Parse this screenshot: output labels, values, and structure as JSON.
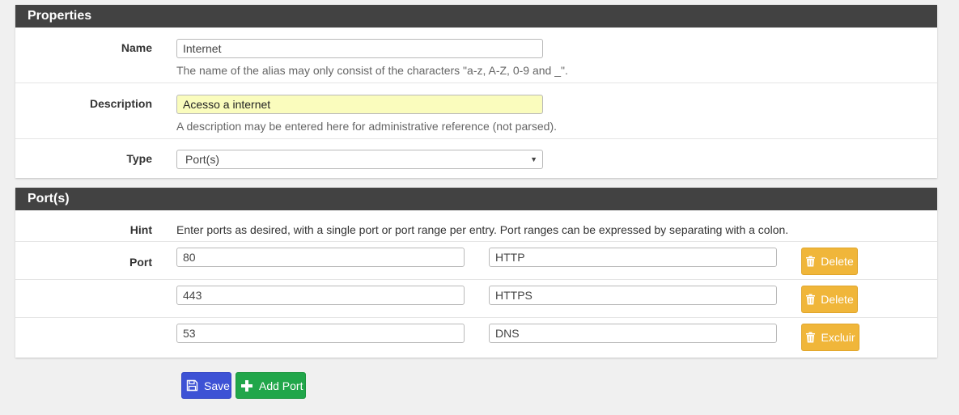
{
  "properties": {
    "heading": "Properties",
    "name": {
      "label": "Name",
      "value": "Internet",
      "help": "The name of the alias may only consist of the characters \"a-z, A-Z, 0-9 and _\"."
    },
    "description": {
      "label": "Description",
      "value": "Acesso a internet",
      "help": "A description may be entered here for administrative reference (not parsed)."
    },
    "type": {
      "label": "Type",
      "selected": "Port(s)"
    }
  },
  "ports": {
    "heading": "Port(s)",
    "hint_label": "Hint",
    "hint_text": "Enter ports as desired, with a single port or port range per entry. Port ranges can be expressed by separating with a colon.",
    "port_label": "Port",
    "entries": [
      {
        "port": "80",
        "description": "HTTP",
        "action": "Delete"
      },
      {
        "port": "443",
        "description": "HTTPS",
        "action": "Delete"
      },
      {
        "port": "53",
        "description": "DNS",
        "action": "Excluir"
      }
    ]
  },
  "actions": {
    "save_label": "Save",
    "add_port_label": "Add Port"
  },
  "colors": {
    "panel_heading": "#424242",
    "delete_button": "#f0b63a",
    "save_button": "#3d52d5",
    "add_button": "#21a64a",
    "description_highlight": "#fafcbd"
  },
  "icons": {
    "delete": "trash-icon",
    "save": "floppy-disk-icon",
    "add": "plus-icon",
    "select": "caret-down-icon"
  }
}
